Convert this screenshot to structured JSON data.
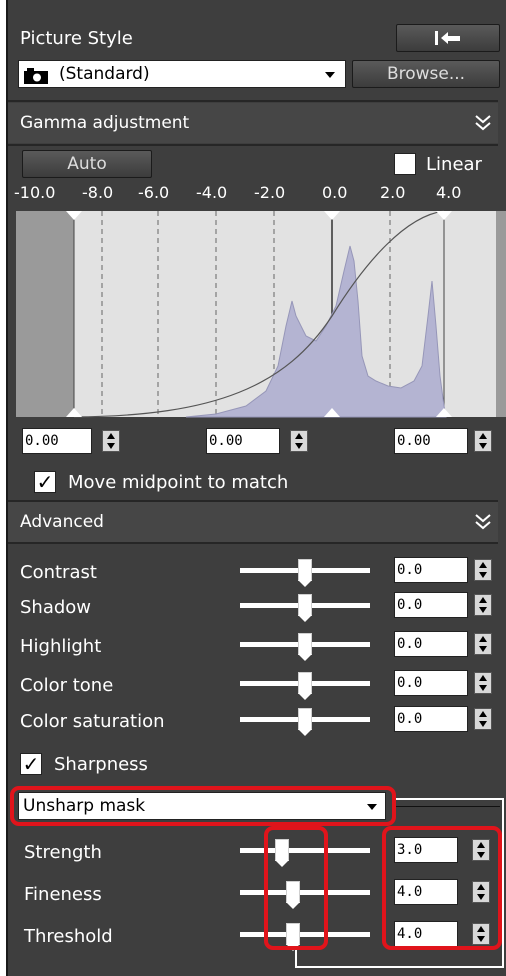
{
  "picture_style": {
    "title": "Picture Style",
    "reset_icon": "undo-arrow-icon",
    "camera_icon": "camera-icon",
    "selected_style": "(Standard)",
    "browse_label": "Browse..."
  },
  "gamma": {
    "header": "Gamma adjustment",
    "collapse_icon": "double-chevron-icon",
    "auto_label": "Auto",
    "linear_label": "Linear",
    "scale_labels": [
      "-10.0",
      "-8.0",
      "-6.0",
      "-4.0",
      "-2.0",
      "0.0",
      "2.0",
      "4.0"
    ],
    "black_point": "0.00",
    "midpoint": "0.00",
    "white_point": "0.00",
    "move_midpoint_label": "Move midpoint to match",
    "move_midpoint_checked": true
  },
  "advanced": {
    "header": "Advanced",
    "collapse_icon": "double-chevron-icon",
    "rows": [
      {
        "label": "Contrast",
        "value": "0.0",
        "position": 0.5
      },
      {
        "label": "Shadow",
        "value": "0.0",
        "position": 0.5
      },
      {
        "label": "Highlight",
        "value": "0.0",
        "position": 0.5
      },
      {
        "label": "Color tone",
        "value": "0.0",
        "position": 0.5
      },
      {
        "label": "Color saturation",
        "value": "0.0",
        "position": 0.5
      }
    ],
    "sharpness_label": "Sharpness",
    "sharpness_checked": true,
    "sharpness_mode": "Unsharp mask",
    "sharp_rows": [
      {
        "label": "Strength",
        "value": "3.0",
        "position": 0.3
      },
      {
        "label": "Fineness",
        "value": "4.0",
        "position": 0.4
      },
      {
        "label": "Threshold",
        "value": "4.0",
        "position": 0.4
      }
    ]
  },
  "colors": {
    "panel_bg": "#3e3e3e",
    "highlight": "#e0141b",
    "histogram": "#b4b4d2"
  }
}
